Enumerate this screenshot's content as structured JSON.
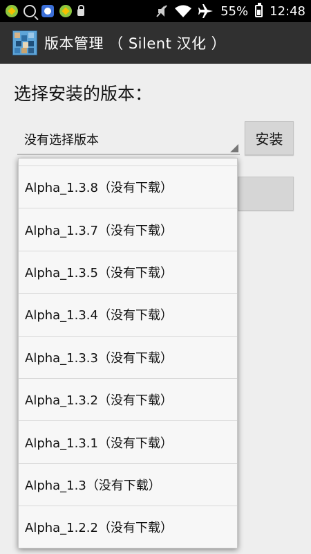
{
  "status_bar": {
    "battery": "55%",
    "time": "12:48",
    "icons": [
      "green-app-icon",
      "search-icon",
      "baidu-icon",
      "green-app-icon",
      "lock-icon",
      "mute-icon",
      "wifi-icon",
      "airplane-icon",
      "battery-icon"
    ]
  },
  "action_bar": {
    "title": "版本管理 （ Silent 汉化 ）"
  },
  "content": {
    "heading": "选择安装的版本：",
    "spinner_value": "没有选择版本",
    "install_label": "安装"
  },
  "dropdown": {
    "items": [
      "Alpha_1.3.8（没有下载）",
      "Alpha_1.3.7（没有下载）",
      "Alpha_1.3.5（没有下载）",
      "Alpha_1.3.4（没有下载）",
      "Alpha_1.3.3（没有下载）",
      "Alpha_1.3.2（没有下载）",
      "Alpha_1.3.1（没有下载）",
      "Alpha_1.3（没有下载）",
      "Alpha_1.2.2（没有下载）"
    ]
  }
}
